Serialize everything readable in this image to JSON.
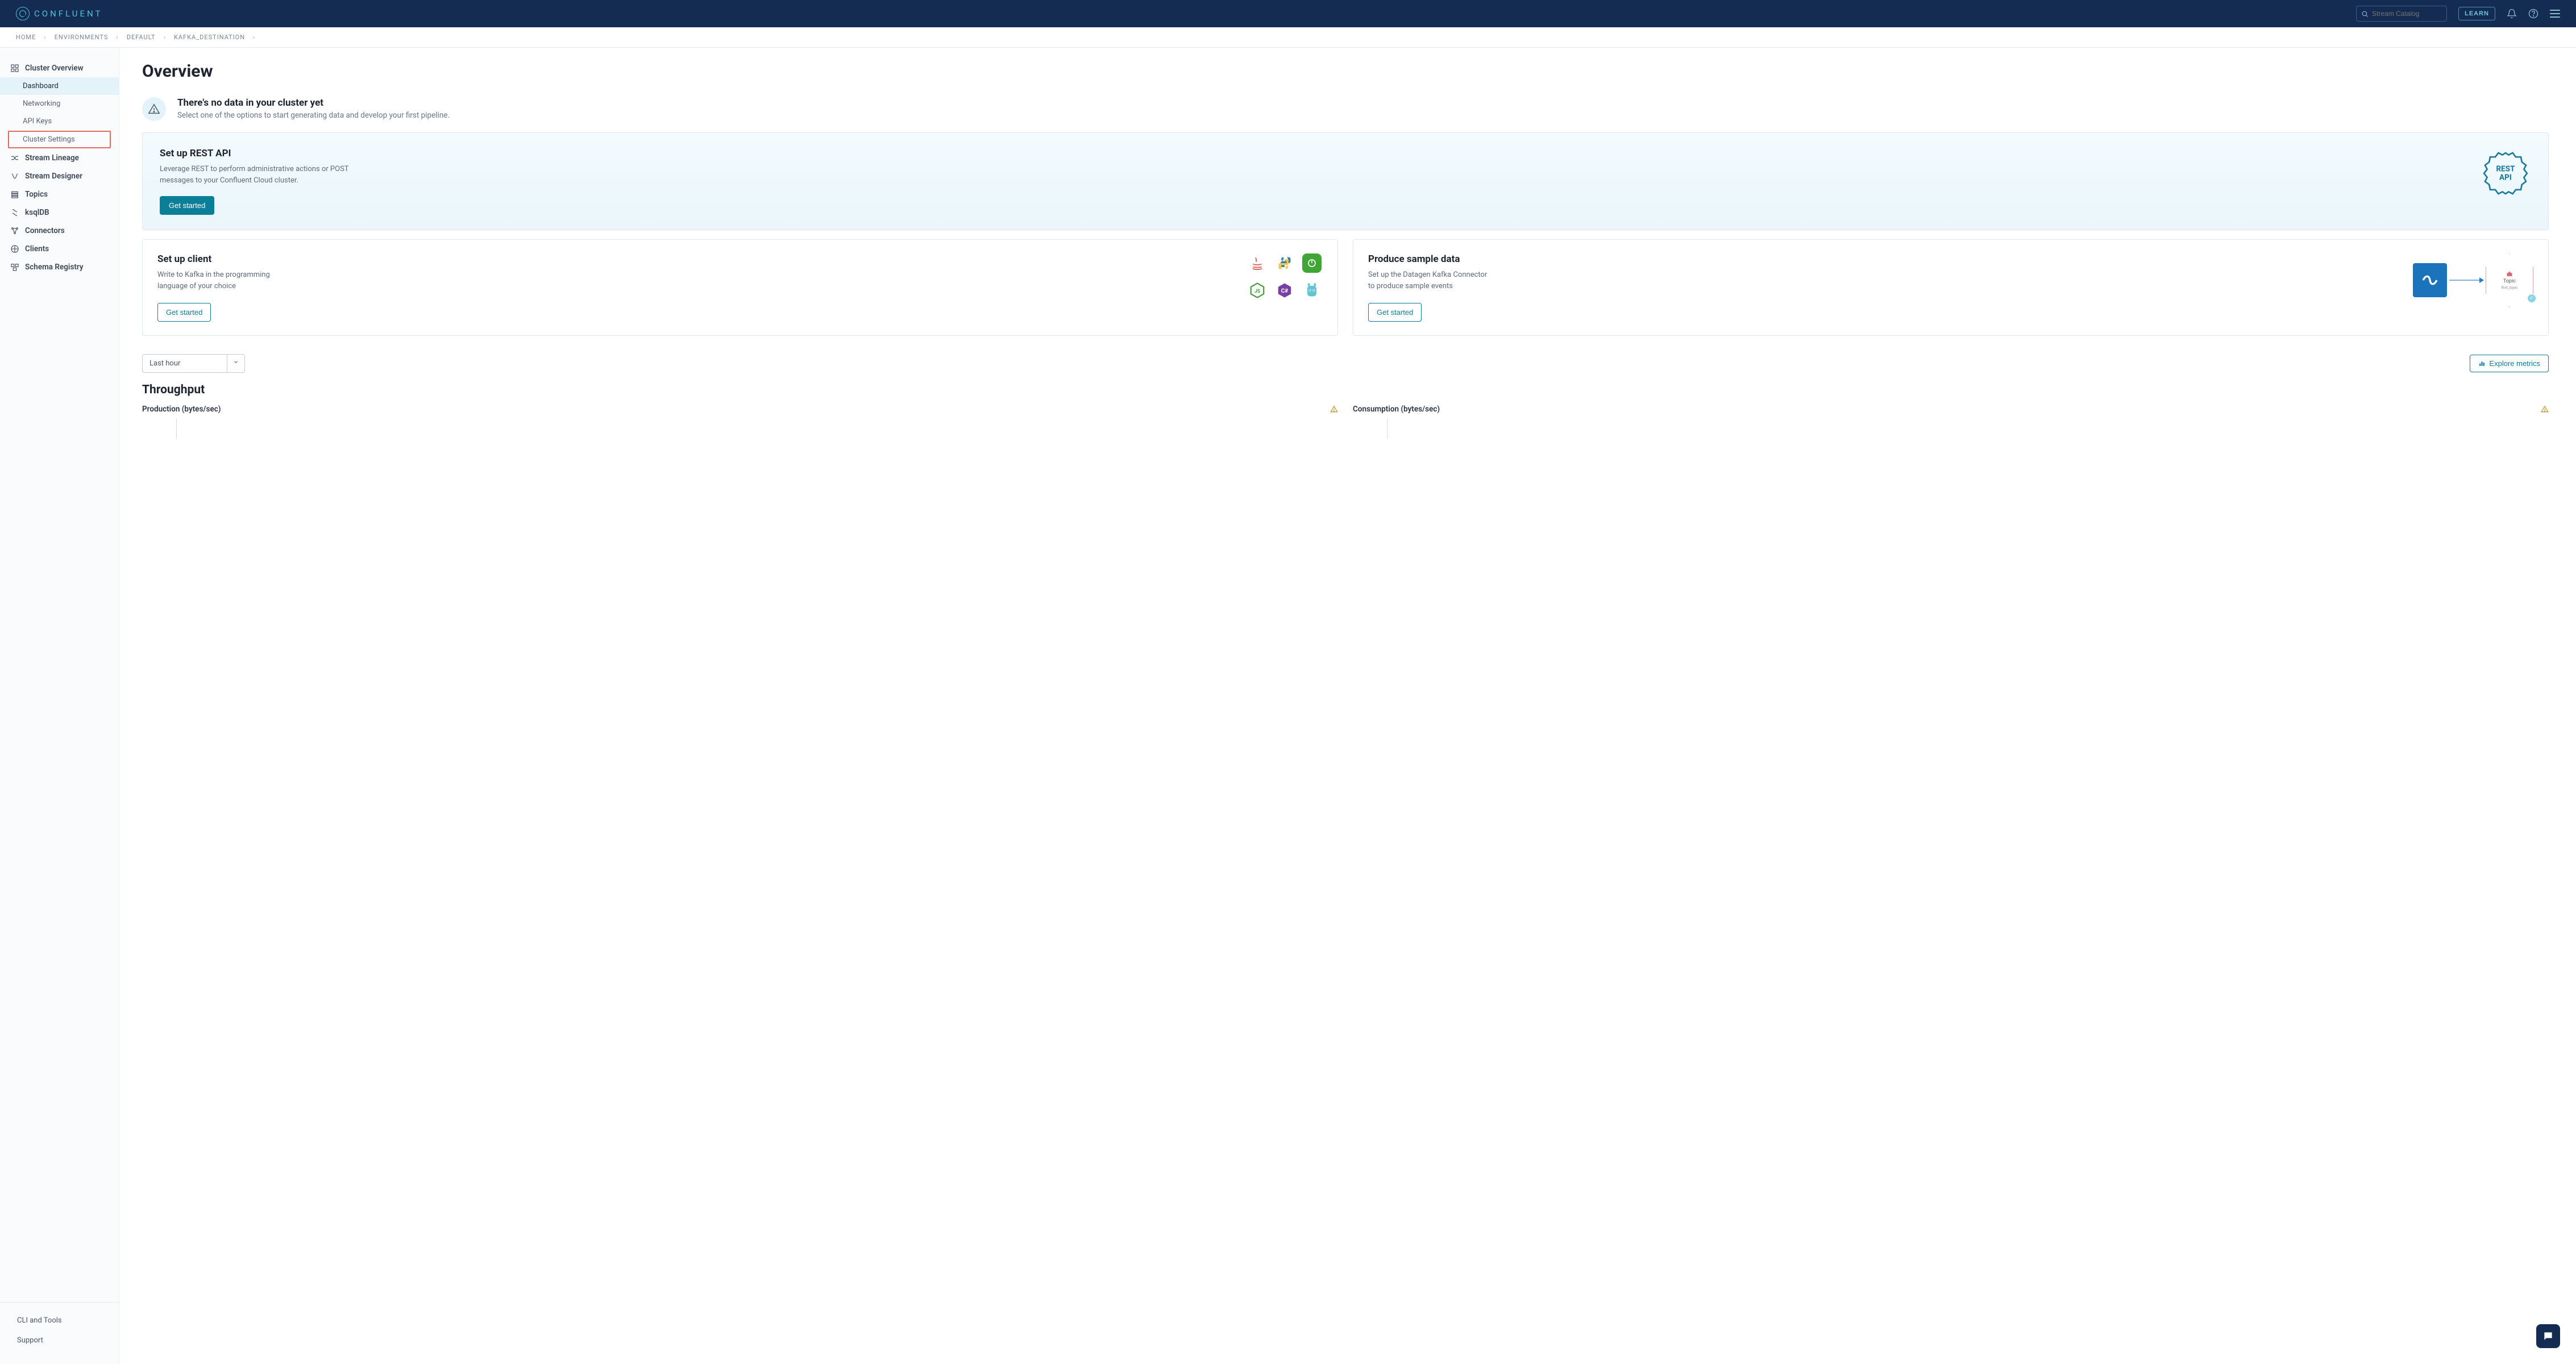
{
  "header": {
    "brand": "CONFLUENT",
    "search_placeholder": "Stream Catalog",
    "learn_label": "LEARN"
  },
  "breadcrumbs": [
    "HOME",
    "ENVIRONMENTS",
    "DEFAULT",
    "KAFKA_DESTINATION"
  ],
  "sidebar": {
    "items": [
      {
        "label": "Cluster Overview",
        "icon": "grid-icon",
        "bold": true
      },
      {
        "label": "Dashboard",
        "sub": true,
        "active": true
      },
      {
        "label": "Networking",
        "sub": true
      },
      {
        "label": "API Keys",
        "sub": true
      },
      {
        "label": "Cluster Settings",
        "sub": true,
        "highlight": true
      },
      {
        "label": "Stream Lineage",
        "icon": "lineage-icon",
        "bold": true
      },
      {
        "label": "Stream Designer",
        "icon": "designer-icon",
        "bold": true
      },
      {
        "label": "Topics",
        "icon": "topics-icon",
        "bold": true
      },
      {
        "label": "ksqlDB",
        "icon": "ksql-icon",
        "bold": true
      },
      {
        "label": "Connectors",
        "icon": "connectors-icon",
        "bold": true
      },
      {
        "label": "Clients",
        "icon": "clients-icon",
        "bold": true
      },
      {
        "label": "Schema Registry",
        "icon": "schema-icon",
        "bold": true
      }
    ],
    "bottom": [
      "CLI and Tools",
      "Support"
    ]
  },
  "page": {
    "title": "Overview",
    "info_title": "There's no data in your cluster yet",
    "info_desc": "Select one of the options to start generating data and develop your first pipeline.",
    "rest_card": {
      "title": "Set up REST API",
      "desc": "Leverage REST to perform administrative actions or POST messages to your Confluent Cloud cluster.",
      "cta": "Get started",
      "badge_line1": "REST",
      "badge_line2": "API"
    },
    "client_card": {
      "title": "Set up client",
      "desc": "Write to Kafka in the programming language of your choice",
      "cta": "Get started"
    },
    "sample_card": {
      "title": "Produce sample data",
      "desc": "Set up the Datagen Kafka Connector to produce sample events",
      "cta": "Get started",
      "hex_line1": "Topic",
      "hex_line2": "first_topic"
    },
    "time_select": "Last hour",
    "explore_label": "Explore metrics",
    "throughput_title": "Throughput",
    "production_label": "Production (bytes/sec)",
    "consumption_label": "Consumption (bytes/sec)"
  }
}
